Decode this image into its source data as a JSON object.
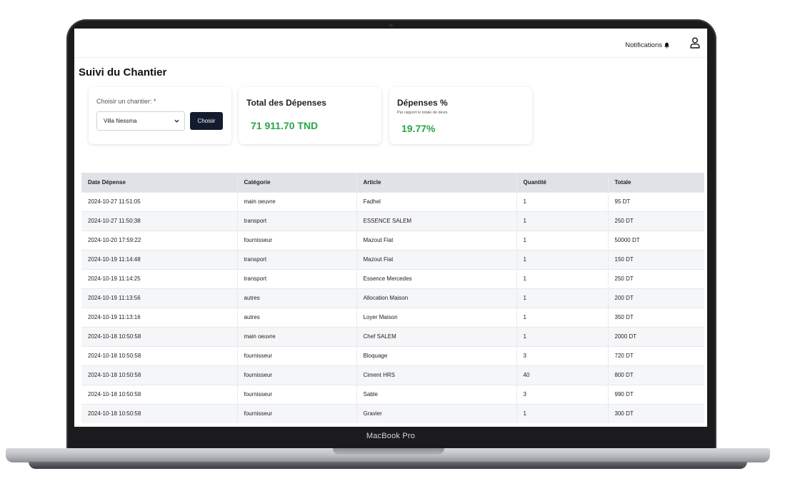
{
  "device": {
    "label": "MacBook Pro"
  },
  "topbar": {
    "notifications_label": "Notifications"
  },
  "page": {
    "title": "Suivi du Chantier"
  },
  "selector": {
    "label": "Choisir un chantier: *",
    "selected": "Villa Nessma",
    "button_label": "Choisir"
  },
  "total_card": {
    "title": "Total des Dépenses",
    "value": "71 911.70 TND"
  },
  "percent_card": {
    "title": "Dépenses %",
    "subtitle": "Par rapport le totale de devis",
    "value": "19.77%"
  },
  "colors": {
    "accent": "#28a745",
    "button": "#131b2e",
    "table_header": "#dfe3e8"
  },
  "table": {
    "headers": [
      "Date Dépense",
      "Catégorie",
      "Article",
      "Quantité",
      "Totale"
    ],
    "rows": [
      [
        "2024-10-27 11:51:05",
        "main oeuvre",
        "Fadhel",
        "1",
        "95 DT"
      ],
      [
        "2024-10-27 11:50:38",
        "transport",
        "ESSENCE SALEM",
        "1",
        "250 DT"
      ],
      [
        "2024-10-20 17:59:22",
        "fournisseur",
        "Mazout Fiat",
        "1",
        "50000 DT"
      ],
      [
        "2024-10-19 11:14:48",
        "transport",
        "Mazout Fiat",
        "1",
        "150 DT"
      ],
      [
        "2024-10-19 11:14:25",
        "transport",
        "Essence Mercedes",
        "1",
        "250 DT"
      ],
      [
        "2024-10-19 11:13:56",
        "autres",
        "Allocation Maison",
        "1",
        "200 DT"
      ],
      [
        "2024-10-19 11:13:16",
        "autres",
        "Loyer Maison",
        "1",
        "350 DT"
      ],
      [
        "2024-10-18 10:50:58",
        "main oeuvre",
        "Chef SALEM",
        "1",
        "2000 DT"
      ],
      [
        "2024-10-18 10:50:58",
        "fournisseur",
        "Bloquage",
        "3",
        "720 DT"
      ],
      [
        "2024-10-18 10:50:58",
        "fournisseur",
        "Ciment HRS",
        "40",
        "800 DT"
      ],
      [
        "2024-10-18 10:50:58",
        "fournisseur",
        "Sable",
        "3",
        "990 DT"
      ],
      [
        "2024-10-18 10:50:58",
        "fournisseur",
        "Gravier",
        "1",
        "300 DT"
      ]
    ]
  }
}
